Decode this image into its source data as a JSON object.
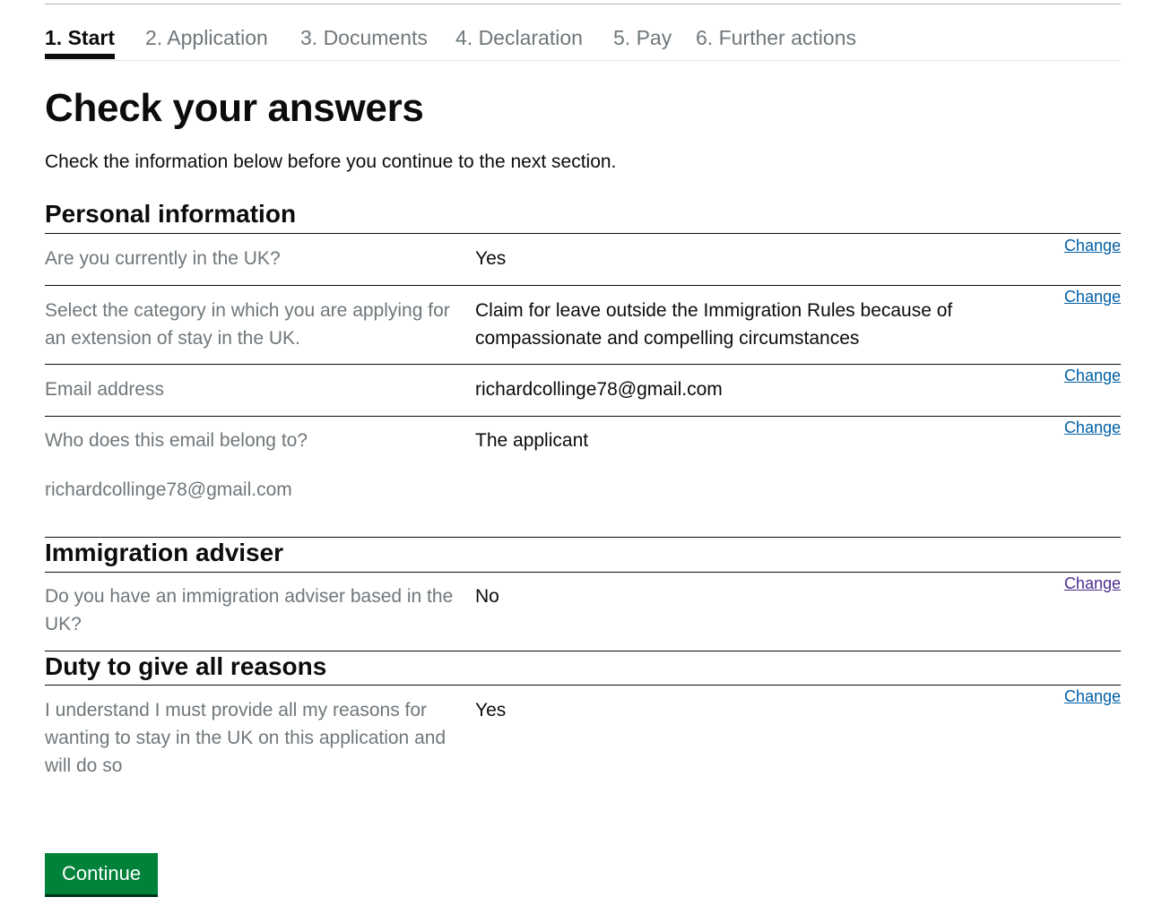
{
  "steps": [
    {
      "label": "1. Start"
    },
    {
      "label": "2. Application"
    },
    {
      "label": "3. Documents"
    },
    {
      "label": "4. Declaration"
    },
    {
      "label": "5. Pay"
    },
    {
      "label": "6. Further actions"
    }
  ],
  "page": {
    "title": "Check your answers",
    "intro": "Check the information below before you continue to the next section."
  },
  "sections": {
    "personal": {
      "heading": "Personal information",
      "rows": [
        {
          "key": "Are you currently in the UK?",
          "value": "Yes",
          "change": "Change"
        },
        {
          "key": "Select the category in which you are applying for an extension of stay in the UK.",
          "value": "Claim for leave outside the Immigration Rules because of compassionate and compelling circumstances",
          "change": "Change"
        },
        {
          "key": "Email address",
          "value": "richardcollinge78@gmail.com",
          "change": "Change"
        },
        {
          "key": "Who does this email belong to?",
          "key_extra": "richardcollinge78@gmail.com",
          "value": "The applicant",
          "change": "Change"
        }
      ]
    },
    "adviser": {
      "heading": "Immigration adviser",
      "rows": [
        {
          "key": "Do you have an immigration adviser based in the UK?",
          "value": "No",
          "change": "Change"
        }
      ]
    },
    "duty": {
      "heading": "Duty to give all reasons",
      "rows": [
        {
          "key": "I understand I must provide all my reasons for wanting to stay in the UK on this application and will do so",
          "value": "Yes",
          "change": "Change"
        }
      ]
    }
  },
  "actions": {
    "continue_label": "Continue"
  },
  "colors": {
    "link": "#005ea5",
    "link_visited": "#4c2c92",
    "button": "#00823b",
    "secondary_text": "#6f777b"
  }
}
